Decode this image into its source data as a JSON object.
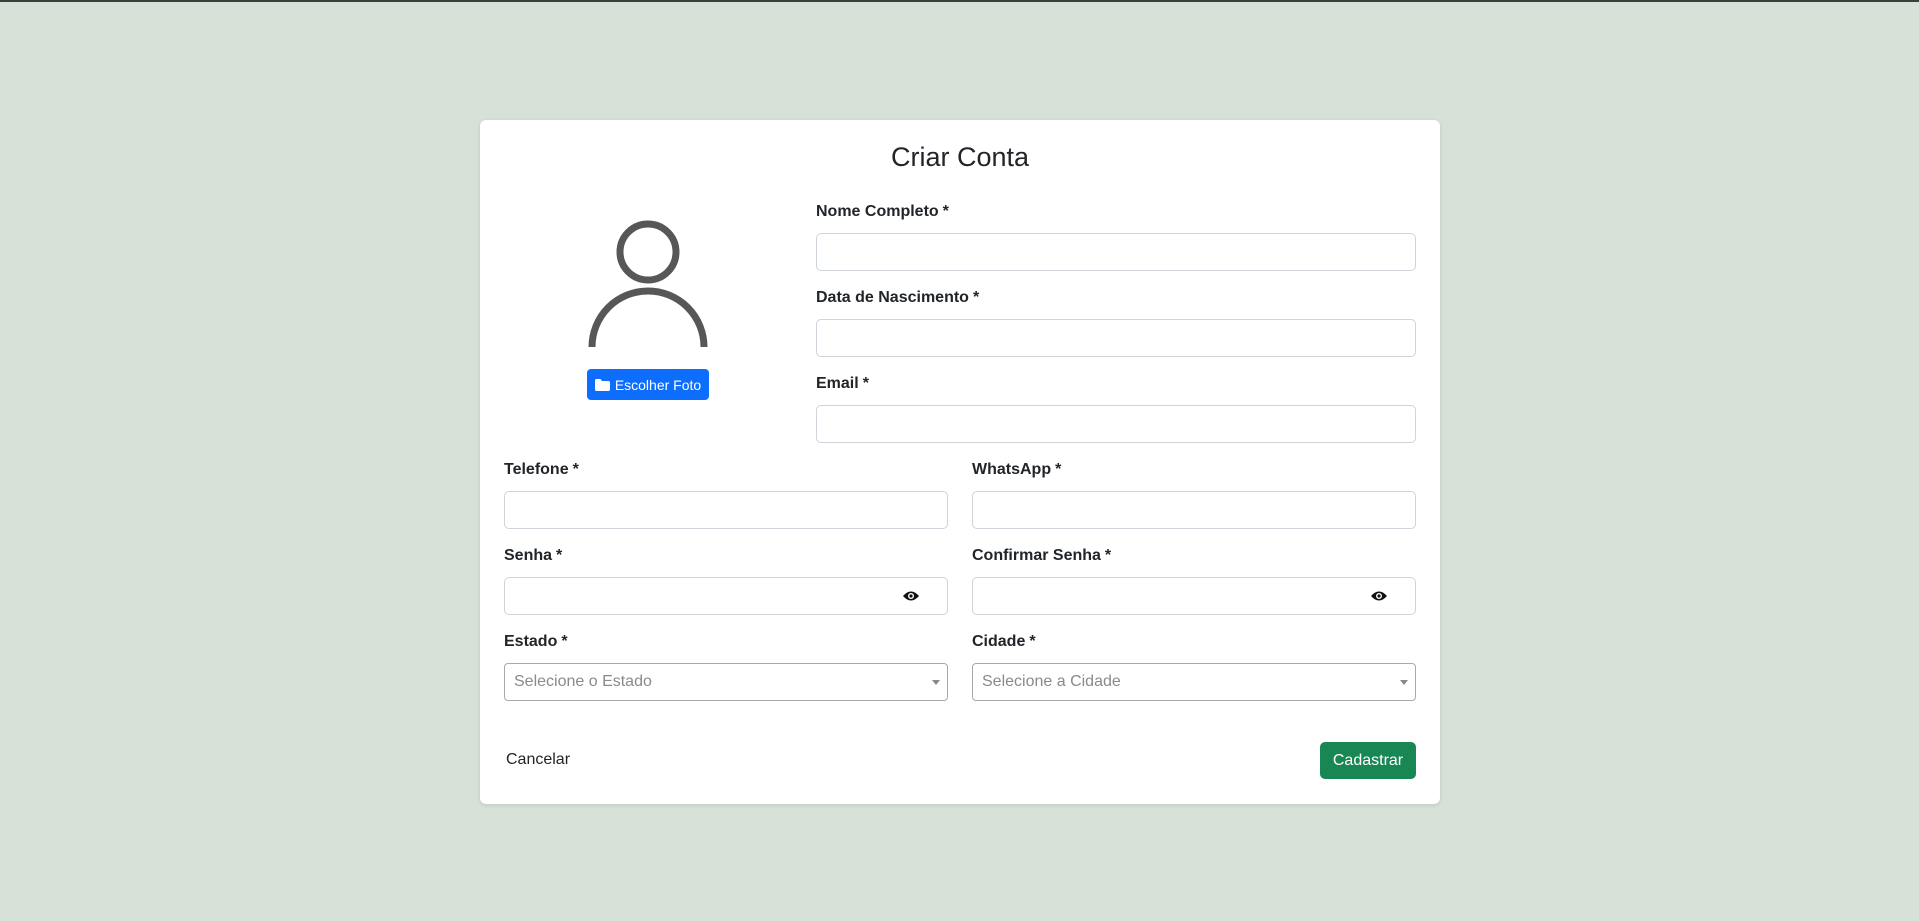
{
  "form": {
    "title": "Criar Conta",
    "required_mark": "*",
    "photo_button": {
      "label": "Escolher Foto",
      "icon": "folder-icon"
    },
    "avatar_icon": "user-avatar-icon",
    "fields": {
      "full_name": {
        "label": "Nome Completo",
        "value": ""
      },
      "birth_date": {
        "label": "Data de Nascimento",
        "value": ""
      },
      "email": {
        "label": "Email",
        "value": ""
      },
      "phone": {
        "label": "Telefone",
        "value": ""
      },
      "whatsapp": {
        "label": "WhatsApp",
        "value": ""
      },
      "password": {
        "label": "Senha",
        "value": "",
        "toggle_icon": "eye-icon"
      },
      "confirm_password": {
        "label": "Confirmar Senha",
        "value": "",
        "toggle_icon": "eye-icon"
      },
      "state": {
        "label": "Estado",
        "placeholder": "Selecione o Estado"
      },
      "city": {
        "label": "Cidade",
        "placeholder": "Selecione a Cidade"
      }
    },
    "cancel_label": "Cancelar",
    "submit_label": "Cadastrar"
  },
  "colors": {
    "background": "#d6e2d8",
    "primary": "#0d6efd",
    "success": "#198754"
  }
}
